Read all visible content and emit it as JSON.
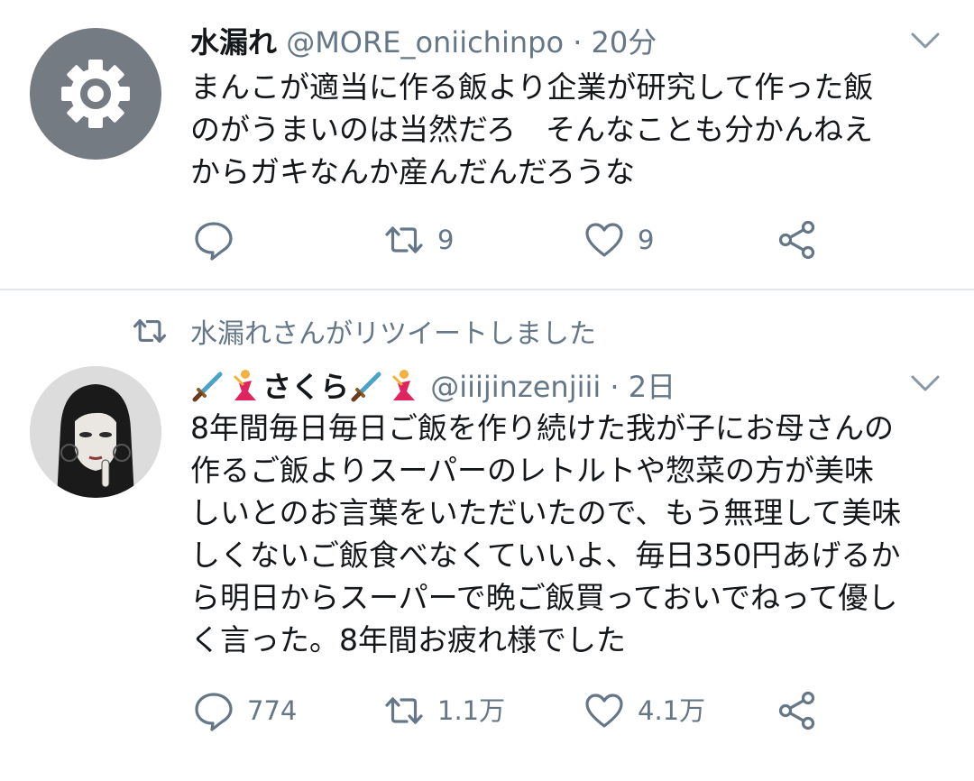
{
  "tweets": [
    {
      "author_name": "水漏れ",
      "handle": "@MORE_oniichinpo",
      "separator": "·",
      "time": "20分",
      "text": "まんこが適当に作る飯より企業が研究して作った飯\nのがうまいのは当然だろ　そんなことも分かんねえ\nからガキなんか産んだんだろうな",
      "reply_count": "",
      "retweet_count": "9",
      "like_count": "9",
      "avatar_icon": "gear-icon"
    },
    {
      "retweeted_by": "水漏れさんがリツイートしました",
      "author_name": "さくら",
      "author_emoji": [
        "dagger",
        "dancer"
      ],
      "handle": "@iiijinzenjiii",
      "separator": "·",
      "time": "2日",
      "text": "8年間毎日毎日ご飯を作り続けた我が子にお母さんの\n作るご飯よりスーパーのレトルトや惣菜の方が美味\nしいとのお言葉をいただいたので、もう無理して美味\nしくないご飯食べなくていいよ、毎日350円あげるか\nら明日からスーパーで晩ご飯買っておいでねって優し\nく言った。8年間お疲れ様でした",
      "reply_count": "774",
      "retweet_count": "1.1万",
      "like_count": "4.1万"
    }
  ],
  "colors": {
    "text_primary": "#14171a",
    "text_secondary": "#657786",
    "icon": "#657786",
    "divider": "#e3e6e8",
    "default_avatar_bg": "#757b82"
  }
}
